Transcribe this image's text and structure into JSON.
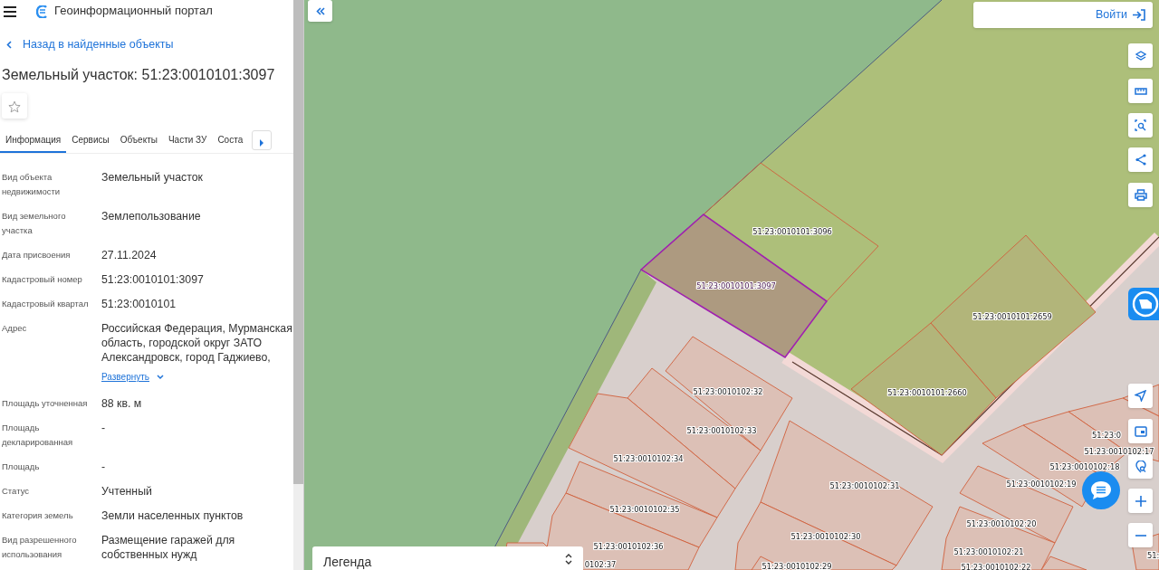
{
  "header": {
    "title": "Геоинформационный портал"
  },
  "back_link": "Назад в найденные объекты",
  "object_title": "Земельный участок: 51:23:0010101:3097",
  "favorite": {
    "on": false
  },
  "tabs": [
    {
      "label": "Информация",
      "selected": true
    },
    {
      "label": "Сервисы",
      "selected": false
    },
    {
      "label": "Объекты",
      "selected": false
    },
    {
      "label": "Части ЗУ",
      "selected": false
    },
    {
      "label": "Соста",
      "selected": false
    }
  ],
  "details": [
    {
      "label": "Вид объекта недвижимости",
      "value": "Земельный участок"
    },
    {
      "label": "Вид земельного участка",
      "value": "Землепользование"
    },
    {
      "label": "Дата присвоения",
      "value": "27.11.2024"
    },
    {
      "label": "Кадастровый номер",
      "value": "51:23:0010101:3097"
    },
    {
      "label": "Кадастровый квартал",
      "value": "51:23:0010101"
    },
    {
      "label": "Адрес",
      "value": "Российская Федерация, Мурманская область, городской округ ЗАТО Александровск, город Гаджиево,",
      "expand_link": "Развернуть"
    },
    {
      "label": "Площадь уточненная",
      "value": "88 кв. м"
    },
    {
      "label": "Площадь декларированная",
      "value": "-"
    },
    {
      "label": "Площадь",
      "value": "-"
    },
    {
      "label": "Статус",
      "value": "Учтенный"
    },
    {
      "label": "Категория земель",
      "value": "Земли населенных пунктов"
    },
    {
      "label": "Вид разрешенного использования",
      "value": "Размещение гаражей для собственных нужд"
    }
  ],
  "login": {
    "label": "Войти"
  },
  "legend": {
    "label": "Легенда"
  },
  "parcels": [
    {
      "label": "51:23:0010101:3096",
      "selected": false
    },
    {
      "label": "51:23:0010101:3097",
      "selected": true
    },
    {
      "label": "51:23:0010101:2659",
      "selected": false
    },
    {
      "label": "51:23:0010102:32",
      "selected": false
    },
    {
      "label": "51:23:0010101:2660",
      "selected": false
    },
    {
      "label": "51:23:0010102:33",
      "selected": false
    },
    {
      "label": "51:23:0",
      "selected": false
    },
    {
      "label": "51:23:0010102:17",
      "selected": false
    },
    {
      "label": "51:23:0010102:34",
      "selected": false
    },
    {
      "label": "51:23:0010102:18",
      "selected": false
    },
    {
      "label": "51:23:0010102:31",
      "selected": false
    },
    {
      "label": "51:23:0010102:19",
      "selected": false
    },
    {
      "label": "51:23:0010102:35",
      "selected": false
    },
    {
      "label": "51:23:0010102:20",
      "selected": false
    },
    {
      "label": "51:23:0010102:30",
      "selected": false
    },
    {
      "label": "51:23:0010102:36",
      "selected": false
    },
    {
      "label": "51:23:0010102:21",
      "selected": false
    },
    {
      "label": "51:",
      "selected": false
    },
    {
      "label": "0102:37",
      "selected": false
    },
    {
      "label": "51:23:0010102:29",
      "selected": false
    },
    {
      "label": "51:23:0010102:22",
      "selected": false
    }
  ]
}
